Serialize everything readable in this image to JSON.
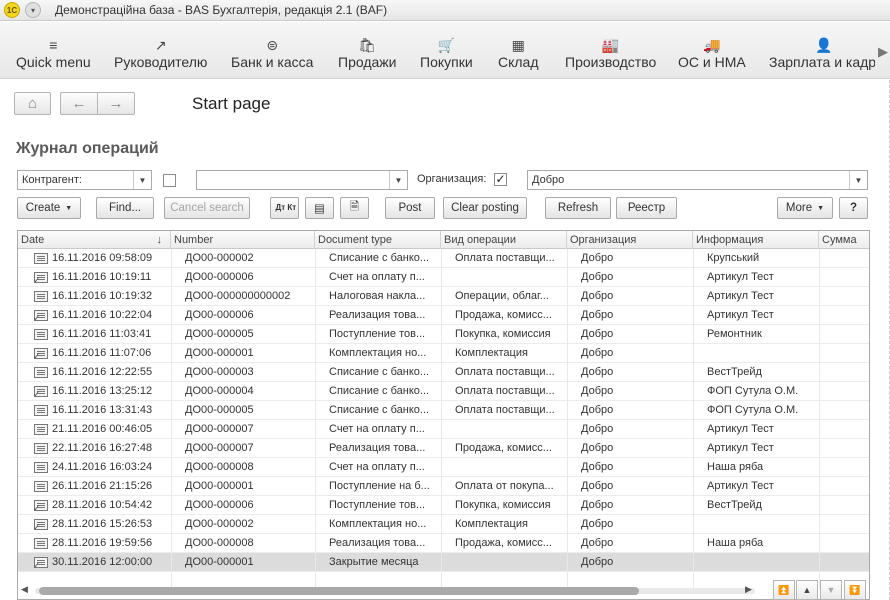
{
  "titlebar": {
    "logo": "1С",
    "title": "Демонстраційна база - BAS Бухгалтерія, редакція 2.1  (BAF)"
  },
  "sections": [
    {
      "label": "Quick menu",
      "icon": "≡"
    },
    {
      "label": "Руководителю",
      "icon": "↗"
    },
    {
      "label": "Банк и касса",
      "icon": "⊜"
    },
    {
      "label": "Продажи",
      "icon": "🛍"
    },
    {
      "label": "Покупки",
      "icon": "🛒"
    },
    {
      "label": "Склад",
      "icon": "▦"
    },
    {
      "label": "Производство",
      "icon": "🏭"
    },
    {
      "label": "ОС и НМА",
      "icon": "🚚"
    },
    {
      "label": "Зарплата и кадры",
      "icon": "👤"
    }
  ],
  "nav": {
    "page_title": "Start page"
  },
  "form": {
    "title": "Журнал операций",
    "filter": {
      "counterparty_label": "Контрагент:",
      "counterparty_value": "",
      "organization_label": "Организация:",
      "organization_value": "Добро"
    },
    "toolbar": {
      "create": "Create",
      "find": "Find...",
      "cancel_search": "Cancel search",
      "dt_kt": "Дт Кт",
      "post": "Post",
      "clear_posting": "Clear posting",
      "refresh": "Refresh",
      "registry": "Реестр",
      "more": "More",
      "help": "?"
    }
  },
  "table": {
    "columns": [
      "Date",
      "Number",
      "Document type",
      "Вид операции",
      "Организация",
      "Информация",
      "Сумма"
    ],
    "rows": [
      {
        "date": "16.11.2016 09:58:09",
        "number": "ДО00-000002",
        "type": "Списание с банко...",
        "op": "Оплата поставщи...",
        "org": "Добро",
        "info": "Крупський",
        "sum": "",
        "posted": false
      },
      {
        "date": "16.11.2016 10:19:11",
        "number": "ДО00-000006",
        "type": "Счет на оплату п...",
        "op": "",
        "org": "Добро",
        "info": "Артикул Тест",
        "sum": "",
        "posted": true
      },
      {
        "date": "16.11.2016 10:19:32",
        "number": "ДО00-000000000002",
        "type": "Налоговая накла...",
        "op": "Операции, облаг...",
        "org": "Добро",
        "info": "Артикул Тест",
        "sum": "",
        "posted": false
      },
      {
        "date": "16.11.2016 10:22:04",
        "number": "ДО00-000006",
        "type": "Реализация това...",
        "op": "Продажа, комисс...",
        "org": "Добро",
        "info": "Артикул Тест",
        "sum": "",
        "posted": true
      },
      {
        "date": "16.11.2016 11:03:41",
        "number": "ДО00-000005",
        "type": "Поступление тов...",
        "op": "Покупка, комиссия",
        "org": "Добро",
        "info": "Ремонтник",
        "sum": "",
        "posted": false
      },
      {
        "date": "16.11.2016 11:07:06",
        "number": "ДО00-000001",
        "type": "Комплектация но...",
        "op": "Комплектация",
        "org": "Добро",
        "info": "",
        "sum": "",
        "posted": true
      },
      {
        "date": "16.11.2016 12:22:55",
        "number": "ДО00-000003",
        "type": "Списание с банко...",
        "op": "Оплата поставщи...",
        "org": "Добро",
        "info": "ВестТрейд",
        "sum": "",
        "posted": false
      },
      {
        "date": "16.11.2016 13:25:12",
        "number": "ДО00-000004",
        "type": "Списание с банко...",
        "op": "Оплата поставщи...",
        "org": "Добро",
        "info": "ФОП Сутула О.М.",
        "sum": "",
        "posted": true
      },
      {
        "date": "16.11.2016 13:31:43",
        "number": "ДО00-000005",
        "type": "Списание с банко...",
        "op": "Оплата поставщи...",
        "org": "Добро",
        "info": "ФОП Сутула О.М.",
        "sum": "",
        "posted": false
      },
      {
        "date": "21.11.2016 00:46:05",
        "number": "ДО00-000007",
        "type": "Счет на оплату п...",
        "op": "",
        "org": "Добро",
        "info": "Артикул Тест",
        "sum": "",
        "posted": false
      },
      {
        "date": "22.11.2016 16:27:48",
        "number": "ДО00-000007",
        "type": "Реализация това...",
        "op": "Продажа, комисс...",
        "org": "Добро",
        "info": "Артикул Тест",
        "sum": "",
        "posted": false
      },
      {
        "date": "24.11.2016 16:03:24",
        "number": "ДО00-000008",
        "type": "Счет на оплату п...",
        "op": "",
        "org": "Добро",
        "info": "Наша ряба",
        "sum": "",
        "posted": false
      },
      {
        "date": "26.11.2016 21:15:26",
        "number": "ДО00-000001",
        "type": "Поступление на б...",
        "op": "Оплата от покупа...",
        "org": "Добро",
        "info": "Артикул Тест",
        "sum": "",
        "posted": false
      },
      {
        "date": "28.11.2016 10:54:42",
        "number": "ДО00-000006",
        "type": "Поступление тов...",
        "op": "Покупка, комиссия",
        "org": "Добро",
        "info": "ВестТрейд",
        "sum": "",
        "posted": true
      },
      {
        "date": "28.11.2016 15:26:53",
        "number": "ДО00-000002",
        "type": "Комплектация но...",
        "op": "Комплектация",
        "org": "Добро",
        "info": "",
        "sum": "",
        "posted": true
      },
      {
        "date": "28.11.2016 19:59:56",
        "number": "ДО00-000008",
        "type": "Реализация това...",
        "op": "Продажа, комисс...",
        "org": "Добро",
        "info": "Наша ряба",
        "sum": "",
        "posted": false
      },
      {
        "date": "30.11.2016 12:00:00",
        "number": "ДО00-000001",
        "type": "Закрытие месяца",
        "op": "",
        "org": "Добро",
        "info": "",
        "sum": "",
        "posted": true
      }
    ]
  }
}
